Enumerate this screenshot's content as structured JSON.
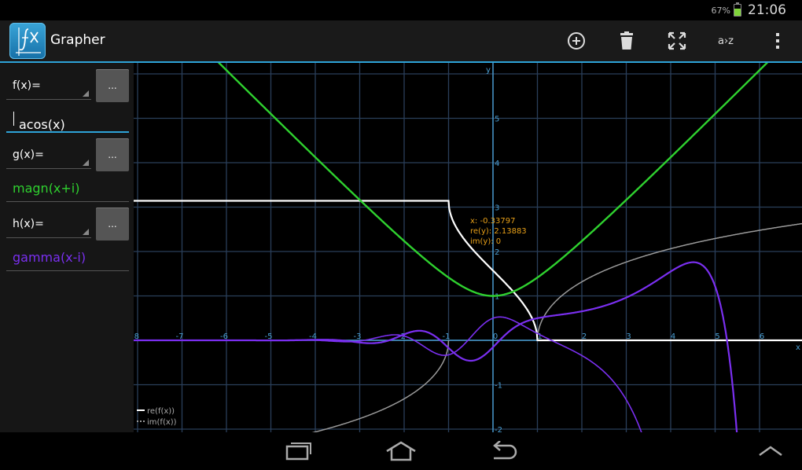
{
  "status": {
    "battery": "67%",
    "battery_level": 0.67,
    "time": "21:06"
  },
  "app": {
    "title": "Grapher"
  },
  "actions": {
    "sort_label": "a›z"
  },
  "functions": [
    {
      "label": "f(x)=",
      "value": "acos(x)",
      "color": "#ffffff",
      "more": "..."
    },
    {
      "label": "g(x)=",
      "value": "magn(x+i)",
      "color": "#2fd12f",
      "more": "..."
    },
    {
      "label": "h(x)=",
      "value": "gamma(x-i)",
      "color": "#7a2ff0",
      "more": "..."
    }
  ],
  "graph": {
    "x_label": "x",
    "y_label": "y",
    "x_ticks": [
      "-8",
      "-7",
      "-6",
      "-5",
      "-4",
      "-3",
      "-2",
      "-1",
      "0",
      "1",
      "2",
      "3",
      "4",
      "5",
      "6",
      "7"
    ],
    "y_ticks": [
      "5",
      "4",
      "3",
      "2",
      "1",
      "-1",
      "-2"
    ],
    "colors": {
      "grid": "#2a3f5a",
      "axis": "#4a9fd4",
      "tick_text": "#4a9fd4",
      "readout": "#e8a018",
      "re_series": "#ffffff",
      "im_series": "#9a9a9a",
      "g_series": "#2fd12f",
      "h_series": "#7a2ff0"
    },
    "readout": {
      "x": "x: -0.33797",
      "re": "re(y): 2.13883",
      "im": "im(y): 0"
    },
    "legend": [
      {
        "label": "re(f(x))"
      },
      {
        "label": "im(f(x))"
      }
    ]
  }
}
